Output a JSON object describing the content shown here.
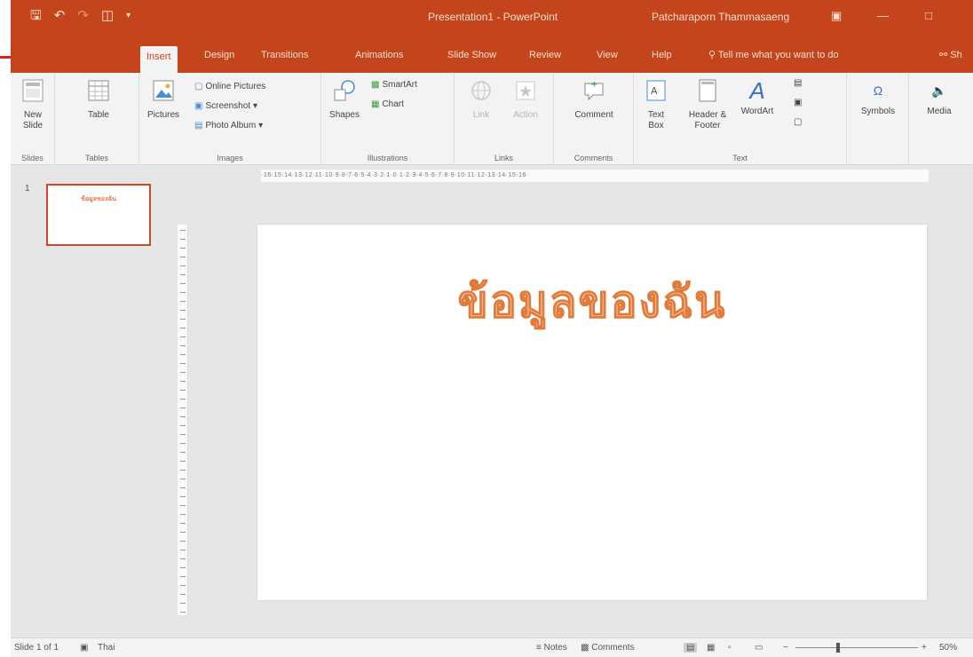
{
  "titlebar": {
    "title": "Presentation1 - PowerPoint",
    "user": "Patcharaporn Thammasaeng"
  },
  "tabs": {
    "insert": "Insert",
    "design": "Design",
    "transitions": "Transitions",
    "animations": "Animations",
    "slideshow": "Slide Show",
    "review": "Review",
    "view": "View",
    "help": "Help",
    "tellme": "Tell me what you want to do",
    "share": "Sh"
  },
  "ribbon": {
    "slides": {
      "new_slide": "New Slide",
      "group": "Slides"
    },
    "tables": {
      "table": "Table",
      "group": "Tables"
    },
    "images": {
      "pictures": "Pictures",
      "online_pictures": "Online Pictures",
      "screenshot": "Screenshot",
      "photo_album": "Photo Album",
      "group": "Images"
    },
    "illustrations": {
      "shapes": "Shapes",
      "smartart": "SmartArt",
      "chart": "Chart",
      "group": "Illustrations"
    },
    "links": {
      "link": "Link",
      "action": "Action",
      "group": "Links"
    },
    "comments": {
      "comment": "Comment",
      "group": "Comments"
    },
    "text": {
      "text_box": "Text Box",
      "header_footer": "Header & Footer",
      "wordart": "WordArt",
      "group": "Text"
    },
    "symbols": {
      "symbols": "Symbols"
    },
    "media": {
      "media": "Media"
    }
  },
  "thumbnail": {
    "number": "1"
  },
  "ruler": {
    "horizontal": "·16·15·14·13·12·11·10·9·8·7·6·5·4·3·2·1·0·1·2·3·4·5·6·7·8·9·10·11·12·13·14·15·16·"
  },
  "slide": {
    "title": "ข้อมูลของฉัน"
  },
  "statusbar": {
    "slide_info": "Slide 1 of 1",
    "language": "Thai",
    "notes": "Notes",
    "comments": "Comments",
    "zoom": "50%"
  }
}
